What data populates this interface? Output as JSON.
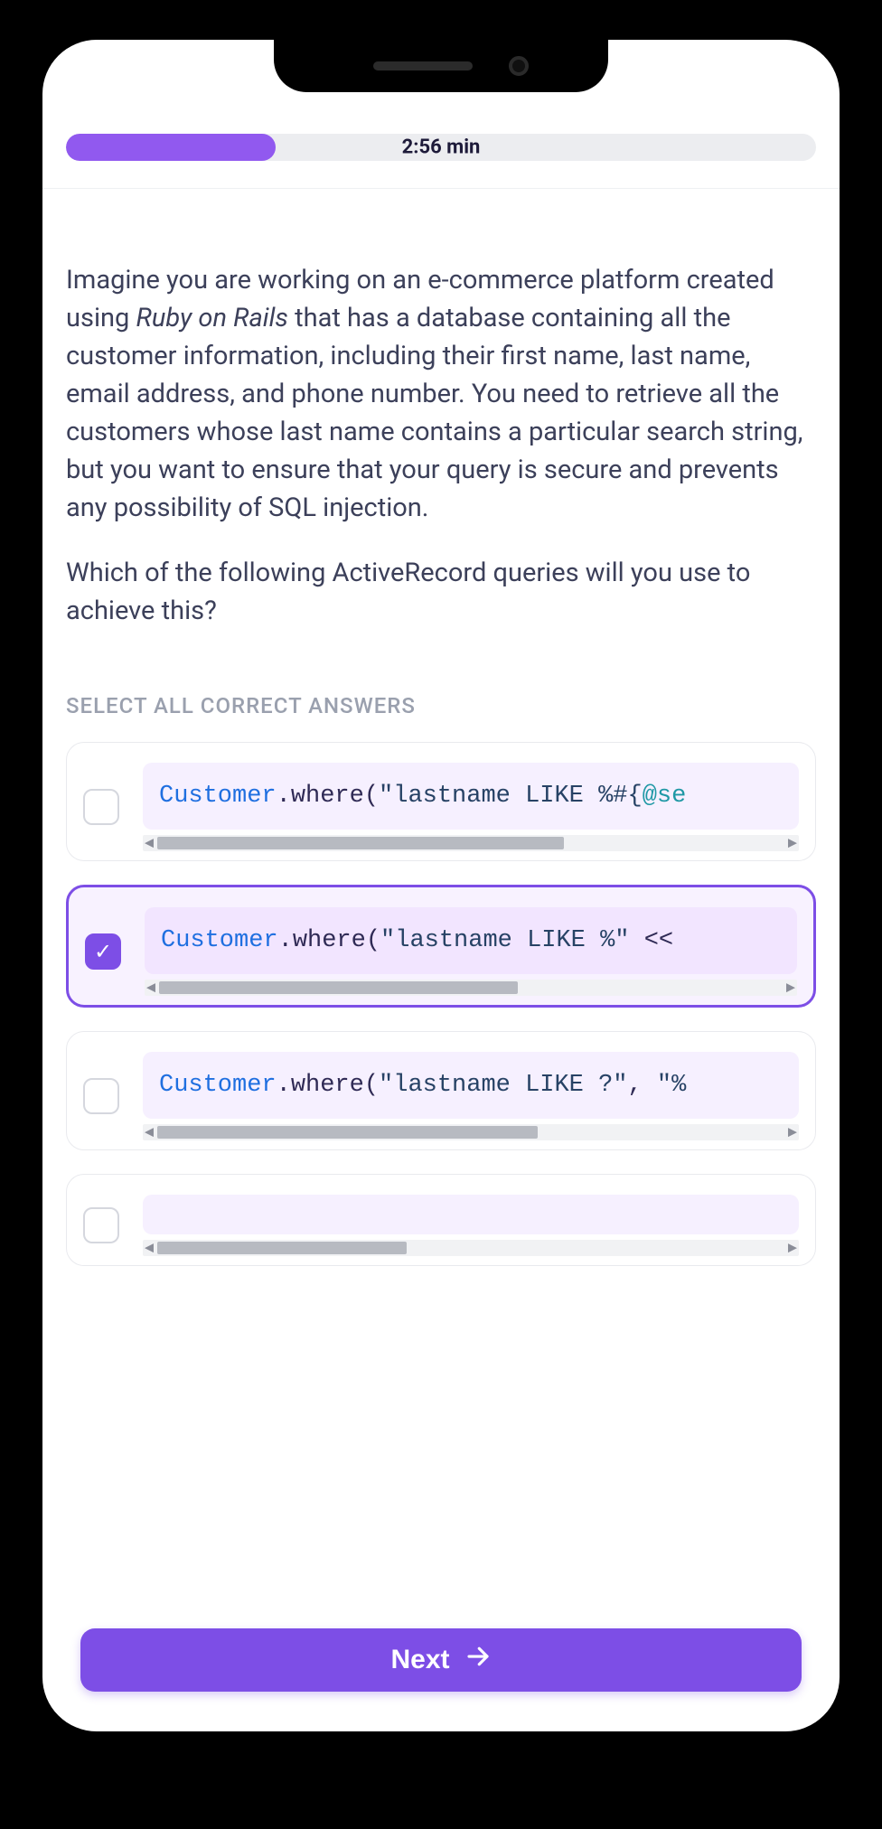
{
  "timer": {
    "text": "2:56 min",
    "progress_percent": 28
  },
  "question": {
    "prefix": "Imagine you are working on an e-commerce platform created using ",
    "emphasis": "Ruby on Rails",
    "suffix": " that has a database containing all the customer information, including their first name, last name, email address, and phone number. You need to retrieve all the customers whose last name contains a particular search string, but you want to ensure that your query is secure and prevents any possibility of SQL injection.",
    "followup": "Which of the following ActiveRecord queries will you use to achieve this?"
  },
  "instruction": "SELECT ALL CORRECT ANSWERS",
  "options": [
    {
      "selected": false,
      "scroll_thumb_percent": 62,
      "code": {
        "const": "Customer",
        "method": ".where",
        "paren_open": "(",
        "string": "\"lastname LIKE %#{",
        "interp": "@se"
      }
    },
    {
      "selected": true,
      "scroll_thumb_percent": 55,
      "code": {
        "const": "Customer",
        "method": ".where",
        "paren_open": "(",
        "string": "\"lastname LIKE %\"",
        "op": " <<"
      }
    },
    {
      "selected": false,
      "scroll_thumb_percent": 58,
      "code": {
        "const": "Customer",
        "method": ".where",
        "paren_open": "(",
        "string": "\"lastname LIKE ?\"",
        "comma": ", ",
        "string2": "\"%"
      }
    },
    {
      "selected": false,
      "scroll_thumb_percent": 38,
      "code": {
        "const": "",
        "method": "",
        "paren_open": "",
        "string": ""
      }
    }
  ],
  "next_label": "Next"
}
